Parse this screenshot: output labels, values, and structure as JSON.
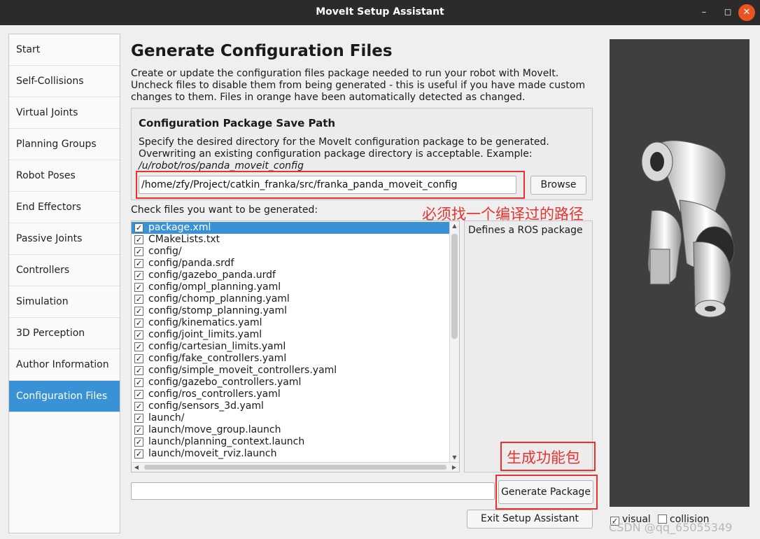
{
  "window": {
    "title": "MoveIt Setup Assistant",
    "min_icon": "minimize-icon",
    "max_icon": "maximize-icon",
    "close_icon": "close-icon"
  },
  "sidebar": {
    "items": [
      {
        "label": "Start",
        "active": false
      },
      {
        "label": "Self-Collisions",
        "active": false
      },
      {
        "label": "Virtual Joints",
        "active": false
      },
      {
        "label": "Planning Groups",
        "active": false
      },
      {
        "label": "Robot Poses",
        "active": false
      },
      {
        "label": "End Effectors",
        "active": false
      },
      {
        "label": "Passive Joints",
        "active": false
      },
      {
        "label": "Controllers",
        "active": false
      },
      {
        "label": "Simulation",
        "active": false
      },
      {
        "label": "3D Perception",
        "active": false
      },
      {
        "label": "Author Information",
        "active": false
      },
      {
        "label": "Configuration Files",
        "active": true
      }
    ],
    "active_color": "#3a92d6"
  },
  "main": {
    "title": "Generate Configuration Files",
    "description": "Create or update the configuration files package needed to run your robot with MoveIt. Uncheck files to disable them from being generated - this is useful if you have made custom changes to them. Files in orange have been automatically detected as changed.",
    "save_path": {
      "title": "Configuration Package Save Path",
      "description": "Specify the desired directory for the MoveIt configuration package to be generated. Overwriting an existing configuration package directory is acceptable. Example: ",
      "example": "/u/robot/ros/panda_moveit_config",
      "path_value": "/home/zfy/Project/catkin_franka/src/franka_panda_moveit_config",
      "browse_label": "Browse"
    },
    "check_label": "Check files you want to be generated:",
    "files": [
      {
        "name": "package.xml",
        "checked": true
      },
      {
        "name": "CMakeLists.txt",
        "checked": true
      },
      {
        "name": "config/",
        "checked": true
      },
      {
        "name": "config/panda.srdf",
        "checked": true
      },
      {
        "name": "config/gazebo_panda.urdf",
        "checked": true
      },
      {
        "name": "config/ompl_planning.yaml",
        "checked": true
      },
      {
        "name": "config/chomp_planning.yaml",
        "checked": true
      },
      {
        "name": "config/stomp_planning.yaml",
        "checked": true
      },
      {
        "name": "config/kinematics.yaml",
        "checked": true
      },
      {
        "name": "config/joint_limits.yaml",
        "checked": true
      },
      {
        "name": "config/cartesian_limits.yaml",
        "checked": true
      },
      {
        "name": "config/fake_controllers.yaml",
        "checked": true
      },
      {
        "name": "config/simple_moveit_controllers.yaml",
        "checked": true
      },
      {
        "name": "config/gazebo_controllers.yaml",
        "checked": true
      },
      {
        "name": "config/ros_controllers.yaml",
        "checked": true
      },
      {
        "name": "config/sensors_3d.yaml",
        "checked": true
      },
      {
        "name": "launch/",
        "checked": true
      },
      {
        "name": "launch/move_group.launch",
        "checked": true
      },
      {
        "name": "launch/planning_context.launch",
        "checked": true
      },
      {
        "name": "launch/moveit_rviz.launch",
        "checked": true
      }
    ],
    "selected_file_index": 0,
    "detail_text": "Defines a ROS package",
    "generate_label": "Generate Package",
    "exit_label": "Exit Setup Assistant"
  },
  "viewport": {
    "visual_label": "visual",
    "visual_checked": true,
    "collision_label": "collision",
    "collision_checked": false
  },
  "annotations": {
    "path_note": "必须找一个编译过的路径",
    "generate_note": "生成功能包",
    "color": "#e8322f"
  },
  "watermark": "CSDN @qq_65055349"
}
